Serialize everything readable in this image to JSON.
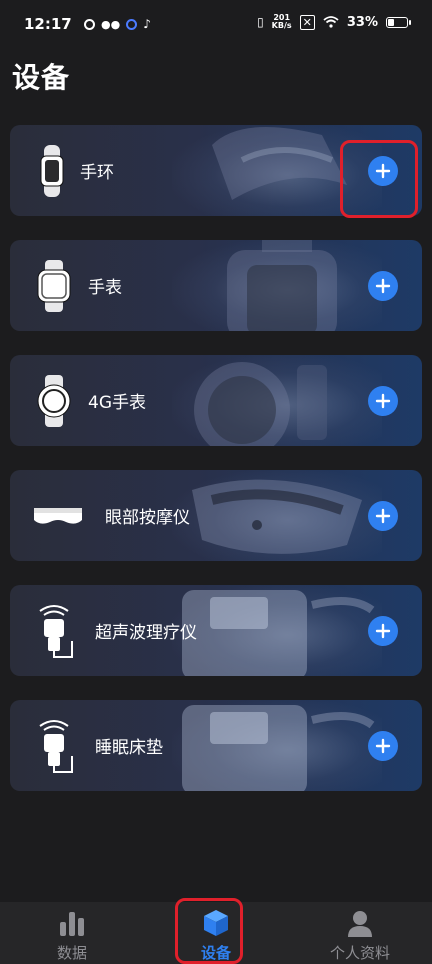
{
  "status_bar": {
    "time": "12:17",
    "network_speed_value": "201",
    "network_speed_unit": "KB/s",
    "battery": "33%",
    "battery_level": 0.33
  },
  "page": {
    "title": "设备"
  },
  "devices": [
    {
      "label": "手环",
      "icon": "band-icon",
      "highlighted": true
    },
    {
      "label": "手表",
      "icon": "square-watch-icon",
      "highlighted": false
    },
    {
      "label": "4G手表",
      "icon": "round-watch-icon",
      "highlighted": false
    },
    {
      "label": "眼部按摩仪",
      "icon": "eye-mask-icon",
      "highlighted": false
    },
    {
      "label": "超声波理疗仪",
      "icon": "ultrasound-probe-icon",
      "highlighted": false
    },
    {
      "label": "睡眠床垫",
      "icon": "ultrasound-probe-icon",
      "highlighted": false
    }
  ],
  "bottom_nav": {
    "items": [
      {
        "label": "数据",
        "icon": "bar-chart-icon",
        "active": false
      },
      {
        "label": "设备",
        "icon": "cube-icon",
        "active": true
      },
      {
        "label": "个人资料",
        "icon": "person-icon",
        "active": false
      }
    ]
  },
  "colors": {
    "accent": "#2f80f0",
    "highlight": "#e0202b",
    "background": "#1c1c1e"
  }
}
